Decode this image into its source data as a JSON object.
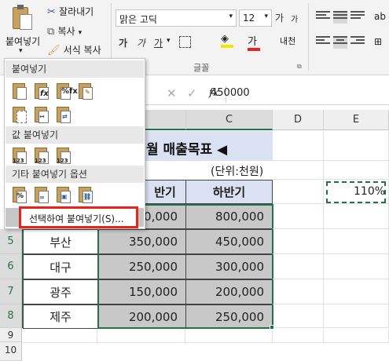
{
  "ribbon": {
    "paste_label": "붙여넣기",
    "cut_label": "잘라내기",
    "copy_label": "복사",
    "format_painter_label": "서식 복사",
    "font_name": "맑은 고딕",
    "font_size": "12",
    "bold": "가",
    "italic": "가",
    "underline": "가",
    "font_color_letter": "가",
    "font_group_label": "글꼴",
    "increase_font": "가",
    "decrease_font": "가",
    "phonetic_label": "내천"
  },
  "paste_menu": {
    "section_paste": "붙여넣기",
    "section_values": "값 붙여넣기",
    "section_other": "기타 붙여넣기 옵션",
    "paste_special": "선택하여 붙여넣기(S)...",
    "icon_label_123": "123"
  },
  "formula_bar": {
    "fx": "fx",
    "value": "450000"
  },
  "sheet": {
    "columns": [
      "C",
      "D",
      "E"
    ],
    "rows": [
      "5",
      "6",
      "7",
      "8",
      "9",
      "10"
    ],
    "title": "월 매출목표 ◀",
    "unit": "(단위:천원)",
    "header_b": "반기",
    "header_c": "하반기",
    "e_value": "110%",
    "table": [
      {
        "city": "",
        "first": "0,000",
        "second": "800,000"
      },
      {
        "city": "부산",
        "first": "350,000",
        "second": "450,000"
      },
      {
        "city": "대구",
        "first": "250,000",
        "second": "300,000"
      },
      {
        "city": "광주",
        "first": "150,000",
        "second": "200,000"
      },
      {
        "city": "제주",
        "first": "200,000",
        "second": "250,000"
      }
    ]
  },
  "colors": {
    "title_fill": "#d9e1f2",
    "header_fill": "#d9e1f2",
    "selection": "#c8c8c8",
    "highlight_box": "#e8231c",
    "marquee": "#217346"
  }
}
